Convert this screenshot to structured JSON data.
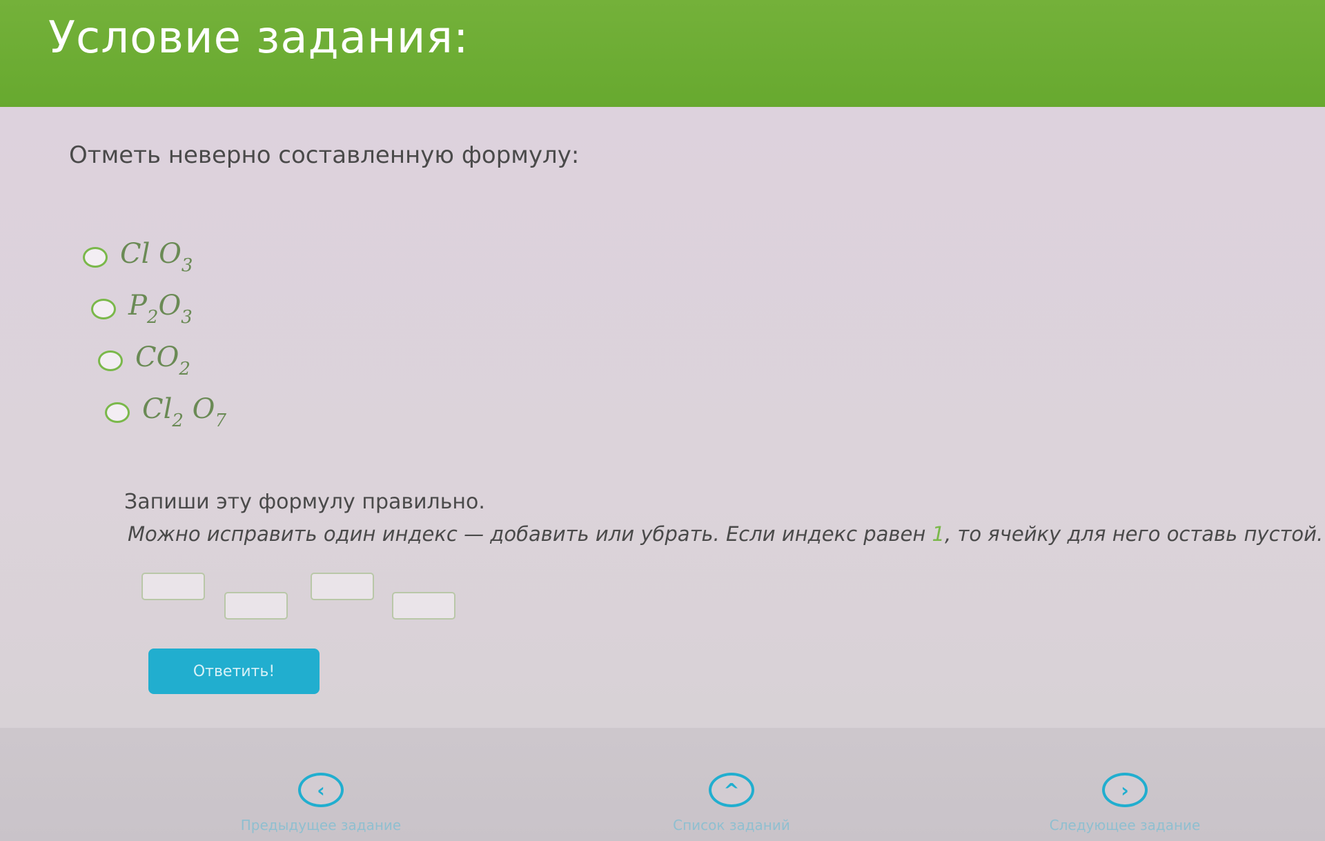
{
  "header": {
    "title": "Условие задания:"
  },
  "task": {
    "question": "Отметь неверно составленную формулу:",
    "options": [
      {
        "parts": [
          "Cl",
          "O",
          "3"
        ],
        "display": [
          [
            "Cl",
            ""
          ],
          [
            "O",
            "3"
          ]
        ]
      },
      {
        "parts": [
          "P",
          "2",
          "O",
          "3"
        ],
        "display": [
          [
            "P",
            "2"
          ],
          [
            "O",
            "3"
          ]
        ]
      },
      {
        "parts": [
          "C",
          "O",
          "2"
        ],
        "display": [
          [
            "C",
            ""
          ],
          [
            "O",
            "2"
          ]
        ]
      },
      {
        "parts": [
          "Cl",
          "2",
          "O",
          "7"
        ],
        "display": [
          [
            "Cl",
            "2"
          ],
          [
            "O",
            "7"
          ]
        ]
      }
    ],
    "instruction_1": "Запиши эту формулу правильно.",
    "instruction_2_before": "Можно исправить один индекс — добавить или убрать. Если индекс равен ",
    "instruction_2_number": "1",
    "instruction_2_after": ", то ячейку для него оставь пустой.",
    "answer_cells": [
      "",
      "",
      "",
      ""
    ],
    "answer_button": "Ответить!"
  },
  "nav": {
    "prev_label": "Предыдущее задание",
    "list_label": "Список заданий",
    "next_label": "Следующее задание"
  },
  "colors": {
    "header": "#6aab33",
    "accent_green": "#7ab84a",
    "button": "#21aecf"
  }
}
